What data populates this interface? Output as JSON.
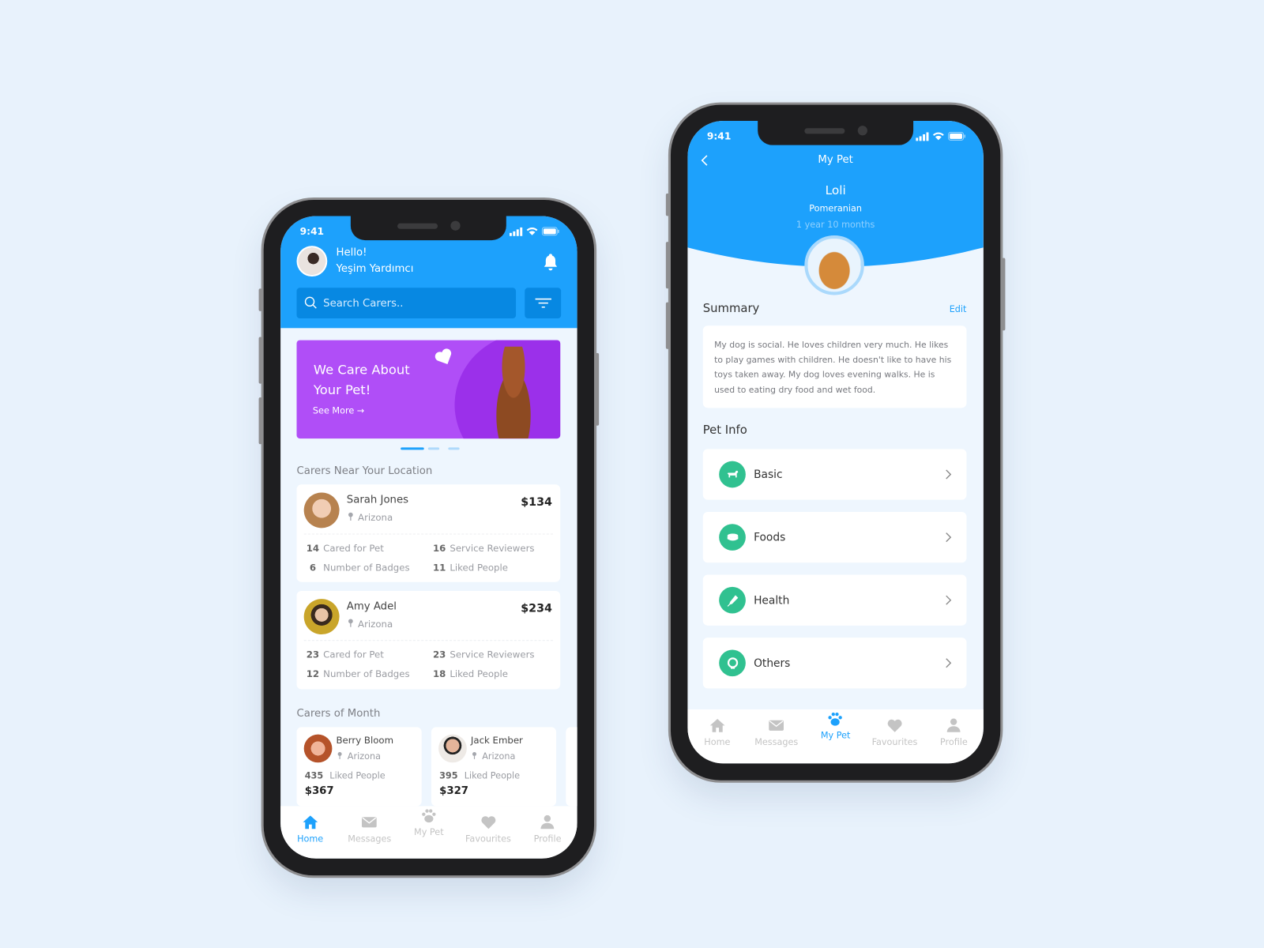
{
  "status_time": "9:41",
  "colors": {
    "primary": "#1da1fc",
    "banner": "#b04ef7",
    "accent_green": "#30c190",
    "background": "#e8f2fc"
  },
  "home": {
    "greeting": "Hello!",
    "user_name": "Yeşim Yardımcı",
    "search_placeholder": "Search Carers..",
    "banner": {
      "title_line1": "We Care About",
      "title_line2": "Your Pet!",
      "link": "See More →"
    },
    "near_title": "Carers Near Your Location",
    "carers": [
      {
        "name": "Sarah Jones",
        "location": "Arizona",
        "price": "$134",
        "cared": "14",
        "cared_label": "Cared for Pet",
        "reviewers": "16",
        "reviewers_label": "Service Reviewers",
        "badges": "6",
        "badges_label": "Number of Badges",
        "liked": "11",
        "liked_label": "Liked People"
      },
      {
        "name": "Amy Adel",
        "location": "Arizona",
        "price": "$234",
        "cared": "23",
        "cared_label": "Cared for Pet",
        "reviewers": "23",
        "reviewers_label": "Service Reviewers",
        "badges": "12",
        "badges_label": "Number of Badges",
        "liked": "18",
        "liked_label": "Liked People"
      }
    ],
    "month_title": "Carers of Month",
    "month_carers": [
      {
        "name": "Berry Bloom",
        "location": "Arizona",
        "liked": "435",
        "liked_label": "Liked People",
        "price": "$367"
      },
      {
        "name": "Jack Ember",
        "location": "Arizona",
        "liked": "395",
        "liked_label": "Liked People",
        "price": "$327"
      }
    ],
    "nav": [
      "Home",
      "Messages",
      "My Pet",
      "Favourites",
      "Profile"
    ],
    "nav_active": "Home"
  },
  "pet": {
    "title": "My Pet",
    "name": "Loli",
    "breed": "Pomeranian",
    "age": "1 year 10 months",
    "summary_title": "Summary",
    "edit": "Edit",
    "summary": "My dog is social. He loves children very much. He likes to play games with children. He doesn't like to have his toys taken away. My dog loves evening walks. He is used to eating dry food and wet food.",
    "info_title": "Pet Info",
    "info_items": [
      {
        "label": "Basic",
        "icon": "dog-icon"
      },
      {
        "label": "Foods",
        "icon": "bowl-icon"
      },
      {
        "label": "Health",
        "icon": "syringe-icon"
      },
      {
        "label": "Others",
        "icon": "collar-icon"
      }
    ],
    "nav": [
      "Home",
      "Messages",
      "My Pet",
      "Favourites",
      "Profile"
    ],
    "nav_active": "My Pet"
  }
}
